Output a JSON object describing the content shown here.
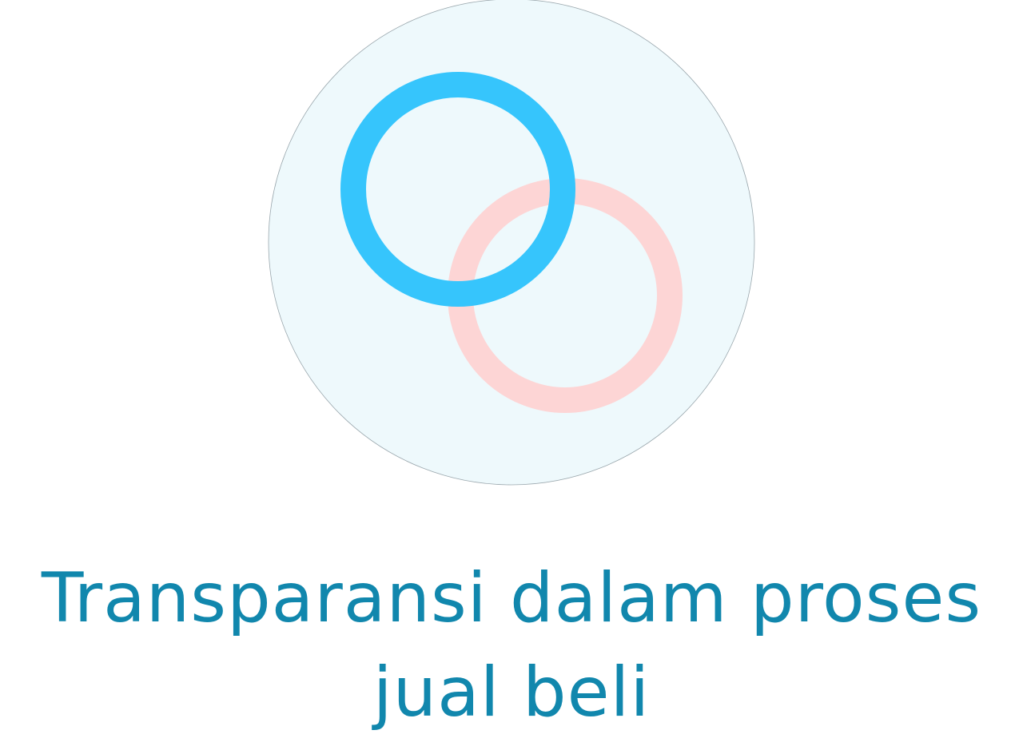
{
  "caption": {
    "line1": "Transparansi dalam proses",
    "line2": "jual beli"
  },
  "icon": {
    "name": "linked-rings-icon",
    "background_color": "#EEF9FC",
    "ring_primary_color": "#36C5FC",
    "ring_secondary_color": "#FDD5D5"
  },
  "colors": {
    "caption_text": "#1187AD"
  }
}
